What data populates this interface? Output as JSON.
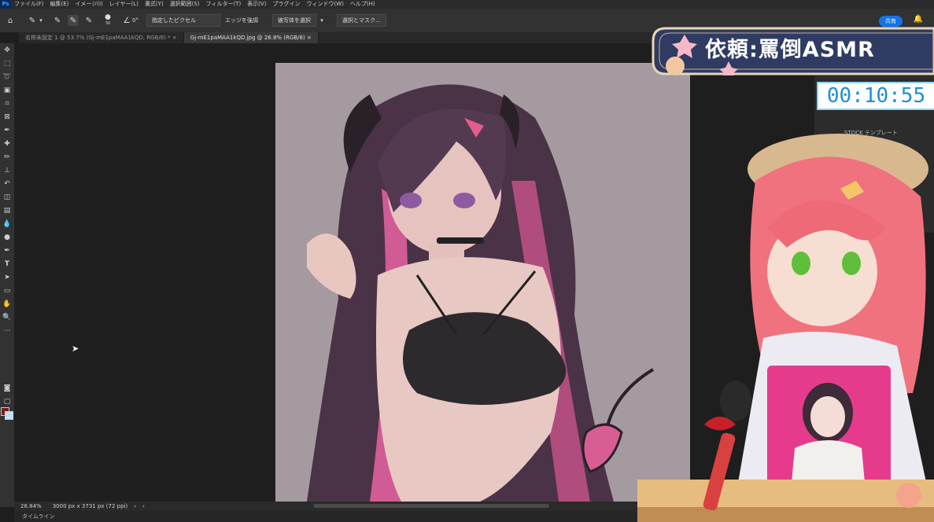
{
  "menubar": {
    "app_icon": "Ps",
    "items": [
      "ファイル(F)",
      "編集(E)",
      "イメージ(I)",
      "レイヤー(L)",
      "書式(Y)",
      "選択範囲(S)",
      "フィルター(T)",
      "表示(V)",
      "プラグイン",
      "ウィンドウ(W)",
      "ヘルプ(H)"
    ]
  },
  "options": {
    "brush_size": "30",
    "angle": "0°",
    "sample_mode": "指定したピクセル",
    "edge_label": "エッジを強調",
    "subject_button": "被写体を選択",
    "mask_button": "選択とマスク...",
    "share_button": "共有"
  },
  "tabs": [
    {
      "label": "名称未設定 1 @ 53.7% (Gj-mE1paMAA1kQD, RGB/8) *"
    },
    {
      "label": "Gj-mE1paMAA1kQD.jpg @ 26.8% (RGB/8)"
    }
  ],
  "status": {
    "zoom": "26.84%",
    "dimensions": "3000 px x 3731 px (72 ppi)"
  },
  "timeline_label": "タイムライン",
  "overlay": {
    "title": "依頼:罵倒ASMR",
    "timer": "00:10:55"
  },
  "panel_rows": [
    "STOCK テンプレート"
  ],
  "colors": {
    "foreground": "#7a1d22",
    "background": "#bfe4ff",
    "accent": "#1473e6"
  }
}
